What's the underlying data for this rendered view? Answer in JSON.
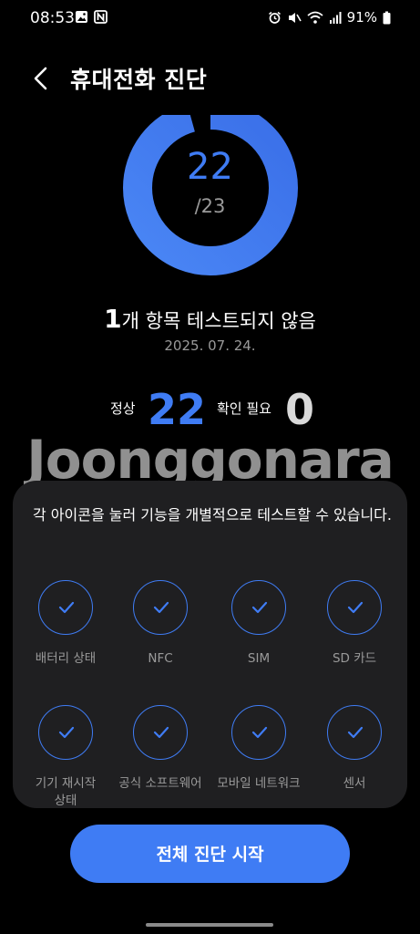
{
  "status_bar": {
    "time": "08:53",
    "battery": "91%",
    "left_icons": [
      "image-icon",
      "nfc-icon"
    ],
    "right_icons": [
      "alarm-icon",
      "mute-icon",
      "wifi-icon",
      "signal-icon",
      "battery-icon"
    ]
  },
  "header": {
    "title": "휴대전화 진단",
    "back_icon": "chevron-left-icon"
  },
  "result": {
    "score": "22",
    "total": "/23",
    "untested_count": "1",
    "untested_text": "개 항목 테스트되지 않음",
    "date": "2025. 07. 24.",
    "progress_fraction": 0.9565
  },
  "summary": {
    "normal_label": "정상",
    "normal_value": "22",
    "check_label": "확인 필요",
    "check_value": "0"
  },
  "watermark": "Joonggonara",
  "panel": {
    "instruction": "각 아이콘을 눌러 기능을 개별적으로 테스트할 수 있습니다.",
    "tests": [
      {
        "label": "배터리 상태",
        "icon": "check-icon"
      },
      {
        "label": "NFC",
        "icon": "check-icon"
      },
      {
        "label": "SIM",
        "icon": "check-icon"
      },
      {
        "label": "SD 카드",
        "icon": "check-icon"
      },
      {
        "label": "기기 재시작 상태",
        "icon": "check-icon"
      },
      {
        "label": "공식 소프트웨어",
        "icon": "check-icon"
      },
      {
        "label": "모바일 네트워크",
        "icon": "check-icon"
      },
      {
        "label": "센서",
        "icon": "check-icon"
      }
    ]
  },
  "action": {
    "start_label": "전체 진단 시작"
  },
  "colors": {
    "accent": "#3f7cf4",
    "background": "#000000",
    "panel": "#1f1f21",
    "muted": "#9a9a9a",
    "zero": "#d9d9d9"
  }
}
